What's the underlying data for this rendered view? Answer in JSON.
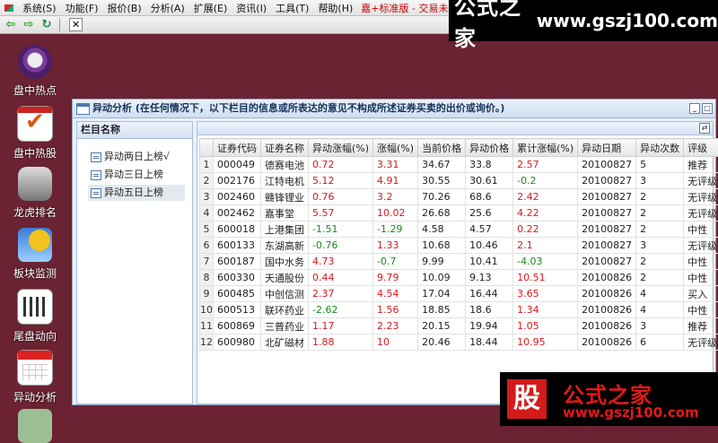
{
  "menu": {
    "items": [
      "系统(S)",
      "功能(F)",
      "报价(B)",
      "分析(A)",
      "扩展(E)",
      "资讯(I)",
      "工具(T)",
      "帮助(H)"
    ],
    "status": "嘉+标准版 - 交易未登录",
    "red_tab": "资讯"
  },
  "watermark_top": {
    "title": "公式之家",
    "url": "www.gszj100.com"
  },
  "watermark_bottom": {
    "badge": "股",
    "title": "公式之家",
    "url": "www.gszj100.com"
  },
  "launcher": [
    {
      "label": "盘中热点",
      "icon": "headset-icon"
    },
    {
      "label": "盘中热股",
      "icon": "checklist-icon"
    },
    {
      "label": "龙虎排名",
      "icon": "database-icon"
    },
    {
      "label": "板块监测",
      "icon": "weather-sun-icon"
    },
    {
      "label": "尾盘动向",
      "icon": "bar-chart-icon"
    },
    {
      "label": "异动分析",
      "icon": "calendar-icon"
    },
    {
      "label": "",
      "icon": "money-icon"
    }
  ],
  "window": {
    "title": "异动分析 (在任何情况下，以下栏目的信息或所表达的意见不构成所述证券买卖的出价或询价。)",
    "column_panel_header": "栏目名称",
    "column_items": [
      "异动两日上榜√",
      "异动三日上榜",
      "异动五日上榜"
    ],
    "selected_item": 2,
    "table": {
      "headers": [
        "",
        "证券代码",
        "证券名称",
        "异动涨幅(%)",
        "涨幅(%)",
        "当前价格",
        "异动价格",
        "累计涨幅(%)",
        "异动日期",
        "异动次数",
        "评级"
      ],
      "rows": [
        [
          "1",
          "000049",
          "德赛电池",
          "0.72",
          "3.31",
          "34.67",
          "33.8",
          "2.57",
          "20100827",
          "5",
          "推荐"
        ],
        [
          "2",
          "002176",
          "江特电机",
          "5.12",
          "4.91",
          "30.55",
          "30.61",
          "-0.2",
          "20100827",
          "3",
          "无评级"
        ],
        [
          "3",
          "002460",
          "赣锋锂业",
          "0.76",
          "3.2",
          "70.26",
          "68.6",
          "2.42",
          "20100827",
          "2",
          "无评级"
        ],
        [
          "4",
          "002462",
          "嘉事堂",
          "5.57",
          "10.02",
          "26.68",
          "25.6",
          "4.22",
          "20100827",
          "2",
          "无评级"
        ],
        [
          "5",
          "600018",
          "上港集团",
          "-1.51",
          "-1.29",
          "4.58",
          "4.57",
          "0.22",
          "20100827",
          "2",
          "中性"
        ],
        [
          "6",
          "600133",
          "东湖高新",
          "-0.76",
          "1.33",
          "10.68",
          "10.46",
          "2.1",
          "20100827",
          "3",
          "无评级"
        ],
        [
          "7",
          "600187",
          "国中水务",
          "4.73",
          "-0.7",
          "9.99",
          "10.41",
          "-4.03",
          "20100827",
          "2",
          "中性"
        ],
        [
          "8",
          "600330",
          "天通股份",
          "0.44",
          "9.79",
          "10.09",
          "9.13",
          "10.51",
          "20100826",
          "2",
          "中性"
        ],
        [
          "9",
          "600485",
          "中创信测",
          "2.37",
          "4.54",
          "17.04",
          "16.44",
          "3.65",
          "20100826",
          "4",
          "买入"
        ],
        [
          "10",
          "600513",
          "联环药业",
          "-2.62",
          "1.56",
          "18.85",
          "18.6",
          "1.34",
          "20100826",
          "4",
          "中性"
        ],
        [
          "11",
          "600869",
          "三普药业",
          "1.17",
          "2.23",
          "20.15",
          "19.94",
          "1.05",
          "20100826",
          "3",
          "推荐"
        ],
        [
          "12",
          "600980",
          "北矿磁材",
          "1.88",
          "10",
          "20.46",
          "18.44",
          "10.95",
          "20100826",
          "6",
          "无评级"
        ]
      ]
    }
  },
  "colors": {
    "up": "#d8191e",
    "down": "#1a8a1a",
    "desktop": "#6b2232"
  }
}
